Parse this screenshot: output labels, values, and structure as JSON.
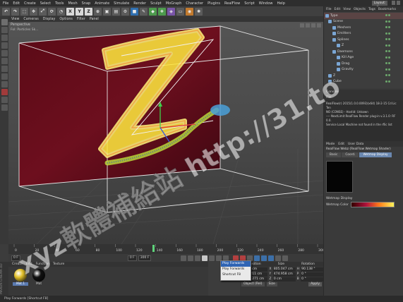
{
  "menubar": {
    "items": [
      "File",
      "Edit",
      "Create",
      "Select",
      "Tools",
      "Mesh",
      "Snap",
      "Animate",
      "Simulate",
      "Render",
      "Sculpt",
      "MoGraph",
      "Character",
      "Plugins",
      "RealFlow",
      "Script",
      "Window",
      "Help"
    ],
    "layout_label": "Layout: Star"
  },
  "toolbar": {
    "axis_x": "X",
    "axis_y": "Y",
    "axis_z": "Z"
  },
  "viewport": {
    "menu": [
      "View",
      "Cameras",
      "Display",
      "Options",
      "Filter",
      "Panel"
    ],
    "label": "Perspective",
    "sublabel": "Fol: Particles Sk..."
  },
  "timeline": {
    "ticks": [
      "0",
      "20",
      "40",
      "60",
      "80",
      "100",
      "120",
      "140",
      "160",
      "180",
      "200",
      "220",
      "240",
      "260",
      "280",
      "300"
    ],
    "start_frame": "0 F",
    "current_frame": "0 F",
    "end_frame": "300 F"
  },
  "materials": {
    "menu": [
      "Create",
      "Edit",
      "Function",
      "Texture"
    ],
    "items": [
      {
        "label": "Mat.1",
        "color": "#e3c12c"
      },
      {
        "label": "Mat",
        "color": "#111111"
      }
    ]
  },
  "coords": {
    "headers": [
      "Position",
      "Size",
      "Rotation"
    ],
    "rows": [
      {
        "ax": "X",
        "pos": "-14 cm",
        "size": "805.047 cm",
        "rax": "H",
        "rot": "90.138 °"
      },
      {
        "ax": "Y",
        "pos": "-1.211 cm",
        "size": "474.958 cm",
        "rax": "P",
        "rot": "0 °"
      },
      {
        "ax": "Z",
        "pos": "-13.271 cm",
        "size": "0 cm",
        "rax": "B",
        "rot": "0 °"
      }
    ],
    "mode": "Object (Rel)",
    "size_mode": "Size",
    "apply": "Apply"
  },
  "popup": {
    "items": [
      "Play Forwards",
      "Play Forwards",
      "Shortcut F8"
    ]
  },
  "status": "Play Forwards [Shortcut F8]",
  "object_manager": {
    "menu": [
      "File",
      "Edit",
      "View",
      "Objects",
      "Tags",
      "Bookmarks"
    ],
    "objects": [
      {
        "name": "Type",
        "selected": true
      },
      {
        "name": "Scene",
        "selected": false
      },
      {
        "name": "Meshers",
        "selected": false
      },
      {
        "name": "Emitters",
        "selected": false
      },
      {
        "name": "Splines",
        "selected": false
      },
      {
        "name": "Z",
        "selected": false
      },
      {
        "name": "Daemons",
        "selected": false
      },
      {
        "name": "Kill Age",
        "selected": false
      },
      {
        "name": "Drag",
        "selected": false
      },
      {
        "name": "Gravity",
        "selected": false
      },
      {
        "name": "Z",
        "selected": false
      },
      {
        "name": "Cube",
        "selected": false
      }
    ]
  },
  "console": {
    "title": "Console",
    "menu": "File",
    "lines": [
      "RealFlow(r) 2015(1.0.0.0093)(x64) 18-2-15 Cd Lic Ten",
      "NO (CONSE) - Hostid: Unkown",
      "",
      "---- NextLimit RealFlow Render plug-in v.3.1.0: RF 0.0.",
      "Service Local Machine not found in the rflic list"
    ]
  },
  "attributes": {
    "menu": [
      "Mode",
      "Edit",
      "User Data"
    ],
    "title": "RealFlow Webz (RealFlow Wetmap Shader)",
    "tabs": [
      "Basic",
      "Coord.",
      "Wetmap Display"
    ],
    "section": "Wetmap Display",
    "color_label": "Wetmap Color"
  },
  "left_logo": "MAXON CINEMA 4D",
  "watermark": "xyz軟體補給站 http://31.to"
}
